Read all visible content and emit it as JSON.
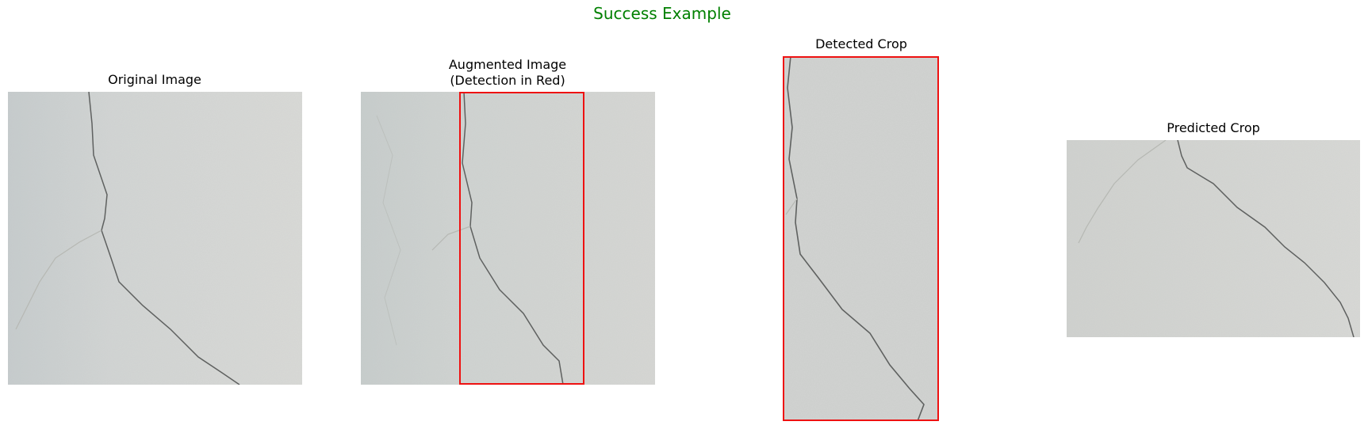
{
  "figure": {
    "title": "Success Example",
    "title_color": "#008000",
    "detection_color": "#ee1111"
  },
  "panels": [
    {
      "title_lines": [
        "Original Image"
      ],
      "image": "concrete-crack-texture"
    },
    {
      "title_lines": [
        "Augmented Image",
        "(Detection in Red)"
      ],
      "image": "augmented-concrete-crack-texture"
    },
    {
      "title_lines": [
        "Detected Crop"
      ],
      "image": "detected-crop-concrete-crack"
    },
    {
      "title_lines": [
        "Predicted Crop"
      ],
      "image": "predicted-crop-concrete-crack"
    }
  ]
}
